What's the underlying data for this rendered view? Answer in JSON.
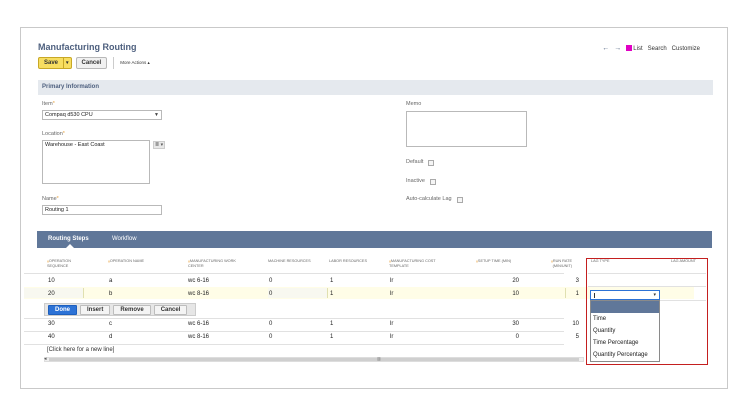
{
  "page": {
    "title": "Manufacturing Routing"
  },
  "nav": {
    "back_icon": "arrow-left-icon",
    "forward_icon": "arrow-right-icon",
    "list_color": "#e100c4",
    "list": "List",
    "search": "Search",
    "customize": "Customize"
  },
  "toolbar": {
    "save": "Save",
    "save_caret": "▾",
    "cancel": "Cancel",
    "more_actions": "More Actions ▴"
  },
  "primary": {
    "section_title": "Primary Information",
    "item_label": "Item",
    "item_value": "Compaq d530 CPU",
    "location_label": "Location",
    "location_value": "Warehouse - East Coast",
    "location_tools": "≣ ▾",
    "name_label": "Name",
    "name_value": "Routing 1",
    "memo_label": "Memo",
    "default_label": "Default",
    "inactive_label": "Inactive",
    "auto_lag_label": "Auto-calculate Lag",
    "required_mark": "*"
  },
  "tabs": {
    "routing_steps": "Routing Steps",
    "workflow": "Workflow"
  },
  "grid": {
    "headers": {
      "op_seq_1": "Operation",
      "op_seq_2": "Sequence",
      "op_name": "Operation Name",
      "mwc_1": "Manufacturing Work",
      "mwc_2": "Center",
      "machine": "Machine Resources",
      "labor": "Labor Resources",
      "mct_1": "Manufacturing Cost",
      "mct_2": "Template",
      "setup": "Setup Time (Min)",
      "run_1": "Run Rate",
      "run_2": "(Min/Unit)",
      "lag_type": "Lag Type",
      "lag_amount": "Lag Amount",
      "star": "⁎"
    },
    "rows": [
      {
        "seq": "10",
        "name": "a",
        "center": "wc 6-16",
        "machine": "0",
        "labor": "1",
        "template": "lr",
        "setup": "20",
        "run": "3"
      },
      {
        "seq": "20",
        "name": "b",
        "center": "wc 8-16",
        "machine": "0",
        "labor": "1",
        "template": "lr",
        "setup": "10",
        "run": "1"
      },
      {
        "seq": "30",
        "name": "c",
        "center": "wc 6-16",
        "machine": "0",
        "labor": "1",
        "template": "lr",
        "setup": "30",
        "run": "10"
      },
      {
        "seq": "40",
        "name": "d",
        "center": "wc 8-16",
        "machine": "0",
        "labor": "1",
        "template": "lr",
        "setup": "0",
        "run": "5"
      }
    ],
    "edit_buttons": {
      "done": "Done",
      "insert": "Insert",
      "remove": "Remove",
      "cancel": "Cancel"
    },
    "new_line": "[Click here for a new line]",
    "scroll_left": "◂",
    "scroll_mid": "▥"
  },
  "lag_dropdown": {
    "arrow": "▾",
    "options": [
      "Time",
      "Quantity",
      "Time Percentage",
      "Quantity Percentage"
    ],
    "highlight_color": "#c41f1f"
  }
}
